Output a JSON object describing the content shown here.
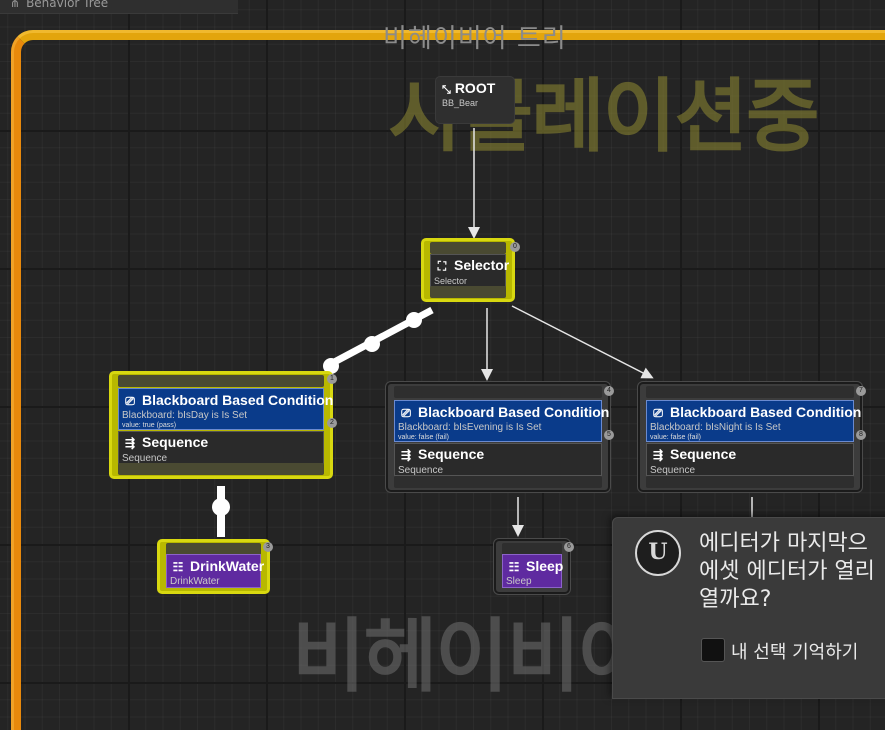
{
  "tab": {
    "title": "Behavior Tree"
  },
  "graph": {
    "title": "비헤이비어 트리",
    "watermark_top": "시뮬레이션중",
    "watermark_bottom": "비헤이비어"
  },
  "nodes": {
    "root": {
      "title": "ROOT",
      "subtitle": "BB_Bear"
    },
    "selector": {
      "title": "Selector",
      "subtitle": "Selector",
      "index": "0"
    },
    "day": {
      "decorator_title": "Blackboard Based Condition",
      "decorator_desc": "Blackboard: bIsDay is Is Set",
      "decorator_value": "value: true (pass)",
      "decorator_index": "2",
      "title": "Sequence",
      "subtitle": "Sequence",
      "index": "1"
    },
    "evening": {
      "decorator_title": "Blackboard Based Condition",
      "decorator_desc": "Blackboard: bIsEvening is Is Set",
      "decorator_value": "value: false (fail)",
      "decorator_index": "5",
      "title": "Sequence",
      "subtitle": "Sequence",
      "index": "4"
    },
    "night": {
      "decorator_title": "Blackboard Based Condition",
      "decorator_desc": "Blackboard: bIsNight is Is Set",
      "decorator_value": "value: false (fail)",
      "decorator_index": "8",
      "title": "Sequence",
      "subtitle": "Sequence",
      "index": "7"
    },
    "drink": {
      "title": "DrinkWater",
      "subtitle": "DrinkWater",
      "index": "3"
    },
    "sleep": {
      "title": "Sleep",
      "subtitle": "Sleep",
      "index": "6"
    }
  },
  "toast": {
    "message_line1": "에디터가 마지막으",
    "message_line2": "에셋 에디터가 열리",
    "message_line3": "열까요?",
    "remember_label": "내 선택 기억하기",
    "logo_glyph": "U"
  },
  "colors": {
    "active_node": "#b8b800",
    "decorator_blue": "#0a3b8a",
    "task_purple": "#5f2aa0",
    "frame_orange": "#e8890c"
  }
}
